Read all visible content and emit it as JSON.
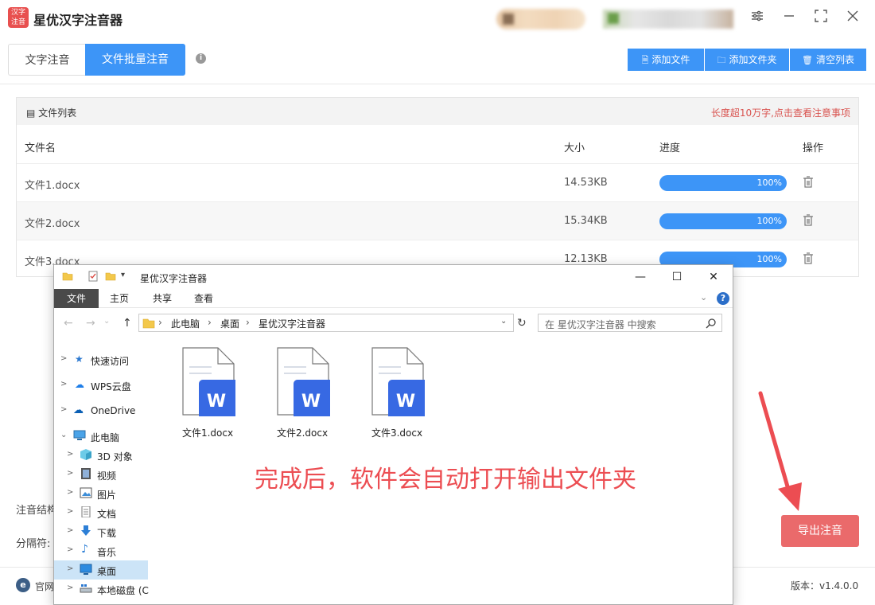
{
  "app": {
    "title": "星优汉字注音器",
    "logo_text": "汉字注音"
  },
  "tabs": [
    {
      "label": "文字注音",
      "active": false
    },
    {
      "label": "文件批量注音",
      "active": true
    }
  ],
  "toolbar": {
    "add_file": "添加文件",
    "add_folder": "添加文件夹",
    "clear_list": "清空列表"
  },
  "file_list": {
    "title": "文件列表",
    "warning": "长度超10万字,点击查看注意事项",
    "columns": {
      "name": "文件名",
      "size": "大小",
      "progress": "进度",
      "action": "操作"
    },
    "rows": [
      {
        "name": "文件1.docx",
        "size": "14.53KB",
        "progress": 1.0,
        "progress_label": "100%"
      },
      {
        "name": "文件2.docx",
        "size": "15.34KB",
        "progress": 1.0,
        "progress_label": "100%"
      },
      {
        "name": "文件3.docx",
        "size": "12.13KB",
        "progress": 1.0,
        "progress_label": "100%"
      }
    ]
  },
  "settings": {
    "structure_label": "注音结构",
    "separator_label": "分隔符:"
  },
  "export_button": "导出注音",
  "footer": {
    "website_label": "官网",
    "version": "版本：v1.4.0.0"
  },
  "explorer": {
    "title": "星优汉字注音器",
    "ribbon_tabs": [
      "文件",
      "主页",
      "共享",
      "查看"
    ],
    "address": [
      "此电脑",
      "桌面",
      "星优汉字注音器"
    ],
    "search_placeholder": "在 星优汉字注音器 中搜索",
    "nav_items": [
      {
        "label": "快速访问"
      },
      {
        "label": "WPS云盘"
      },
      {
        "label": "OneDrive"
      },
      {
        "label": "此电脑"
      },
      {
        "label": "3D 对象"
      },
      {
        "label": "视频"
      },
      {
        "label": "图片"
      },
      {
        "label": "文档"
      },
      {
        "label": "下载"
      },
      {
        "label": "音乐"
      },
      {
        "label": "桌面"
      },
      {
        "label": "本地磁盘 (C"
      }
    ],
    "files": [
      "文件1.docx",
      "文件2.docx",
      "文件3.docx"
    ]
  },
  "annotation": "完成后，软件会自动打开输出文件夹",
  "colors": {
    "accent": "#3d95f7",
    "export": "#ea6a6b",
    "annotation": "#ec4d52",
    "word": "#2f5ed8"
  }
}
